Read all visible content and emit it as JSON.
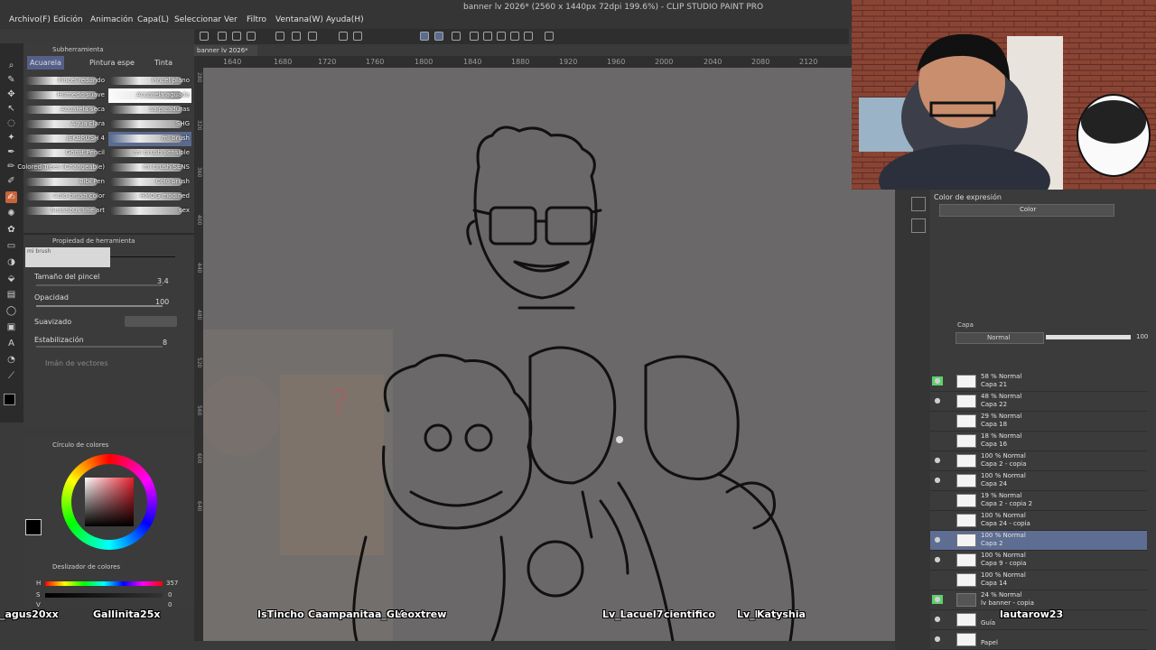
{
  "window_title": "banner lv 2026* (2560 x 1440px 72dpi 199.6%) - CLIP STUDIO PAINT PRO",
  "menu": [
    "Archivo(F)",
    "Edición",
    "Animación",
    "Capa(L)",
    "Seleccionar",
    "Ver",
    "Filtro",
    "Ventana(W)",
    "Ayuda(H)"
  ],
  "document_tab": "banner lv 2026*",
  "subtool": {
    "header": "Subherramienta",
    "tabs": [
      "Acuarela",
      "Pintura espe",
      "Tinta"
    ],
    "brushes_left": [
      "Pincel redondo",
      "Húmedo suave",
      "Acuarela seca",
      "Agua clara",
      "JEKBRUSH 4",
      "Ghost Pencil",
      "Colored Trees (Changeable)",
      "Bibi Pen",
      "Colo brush color",
      "Sussobus line art"
    ],
    "brushes_right": [
      "Pincel plano",
      "Acuarela aguada",
      "Salpicaduras",
      "SHG",
      "mi brush",
      "mi brush sensible",
      "mi brush SENS",
      "Colo brush",
      "HMOG modified",
      "sex"
    ]
  },
  "tool_property": {
    "header": "Propiedad de herramienta",
    "preset_name": "mi brush",
    "brush_size_label": "Tamaño del pincel",
    "brush_size_value": "3.4",
    "opacity_label": "Opacidad",
    "opacity_value": "100",
    "smoothing_label": "Suavizado",
    "stabilization_label": "Estabilización",
    "stabilization_value": "8",
    "vector_label": "Imán de vectores"
  },
  "color_wheel": {
    "header": "Círculo de colores",
    "main_color": "#000000",
    "sub_color": "#ffffff"
  },
  "color_slider": {
    "header": "Deslizador de colores",
    "h_label": "H",
    "h_value": "357",
    "s_label": "S",
    "s_value": "0",
    "v_label": "V",
    "v_value": "0"
  },
  "ruler_ticks": [
    "1640",
    "1680",
    "1720",
    "1760",
    "1800",
    "1840",
    "1880",
    "1920",
    "1960",
    "2000",
    "2040",
    "2080",
    "2120"
  ],
  "vruler_ticks": [
    "280",
    "320",
    "360",
    "400",
    "440",
    "480",
    "520",
    "560",
    "600",
    "640"
  ],
  "color_expression": {
    "header": "Color de expresión",
    "value": "Color"
  },
  "layers": {
    "header": "Capa",
    "blend_mode": "Normal",
    "opacity": "100",
    "items": [
      {
        "mode": "58 % Normal",
        "name": "Capa 21",
        "visible": true
      },
      {
        "mode": "48 % Normal",
        "name": "Capa 22",
        "visible": true
      },
      {
        "mode": "29 % Normal",
        "name": "Capa 18",
        "visible": false
      },
      {
        "mode": "18 % Normal",
        "name": "Capa 16",
        "visible": false
      },
      {
        "mode": "100 % Normal",
        "name": "Capa 2 - copia",
        "visible": true
      },
      {
        "mode": "100 % Normal",
        "name": "Capa 24",
        "visible": true
      },
      {
        "mode": "19 % Normal",
        "name": "Capa 2 - copia 2",
        "visible": false
      },
      {
        "mode": "100 % Normal",
        "name": "Capa 24 - copia",
        "visible": false
      },
      {
        "mode": "100 % Normal",
        "name": "Capa 2",
        "visible": true
      },
      {
        "mode": "100 % Normal",
        "name": "Capa 9 - copia",
        "visible": true
      },
      {
        "mode": "100 % Normal",
        "name": "Capa 14",
        "visible": false
      },
      {
        "mode": "24 % Normal",
        "name": "lv banner - copia",
        "visible": true
      },
      {
        "mode": "",
        "name": "Guía",
        "visible": true
      },
      {
        "mode": "",
        "name": "Papel",
        "visible": true
      }
    ]
  },
  "viewers": [
    "_agus20xx",
    "Gallinita25x",
    "IsTincho",
    "Caampanitaa_GM",
    "Leoxtrew",
    "Lv_Lacuel7",
    "cientifico",
    "Lv_K",
    "Katyshia",
    "lautarow23"
  ],
  "colors": {
    "selection": "#5e6d92",
    "canvas_bg": "#6a6868",
    "panel": "#3b3b3b",
    "visible_green": "#5ed06a"
  }
}
